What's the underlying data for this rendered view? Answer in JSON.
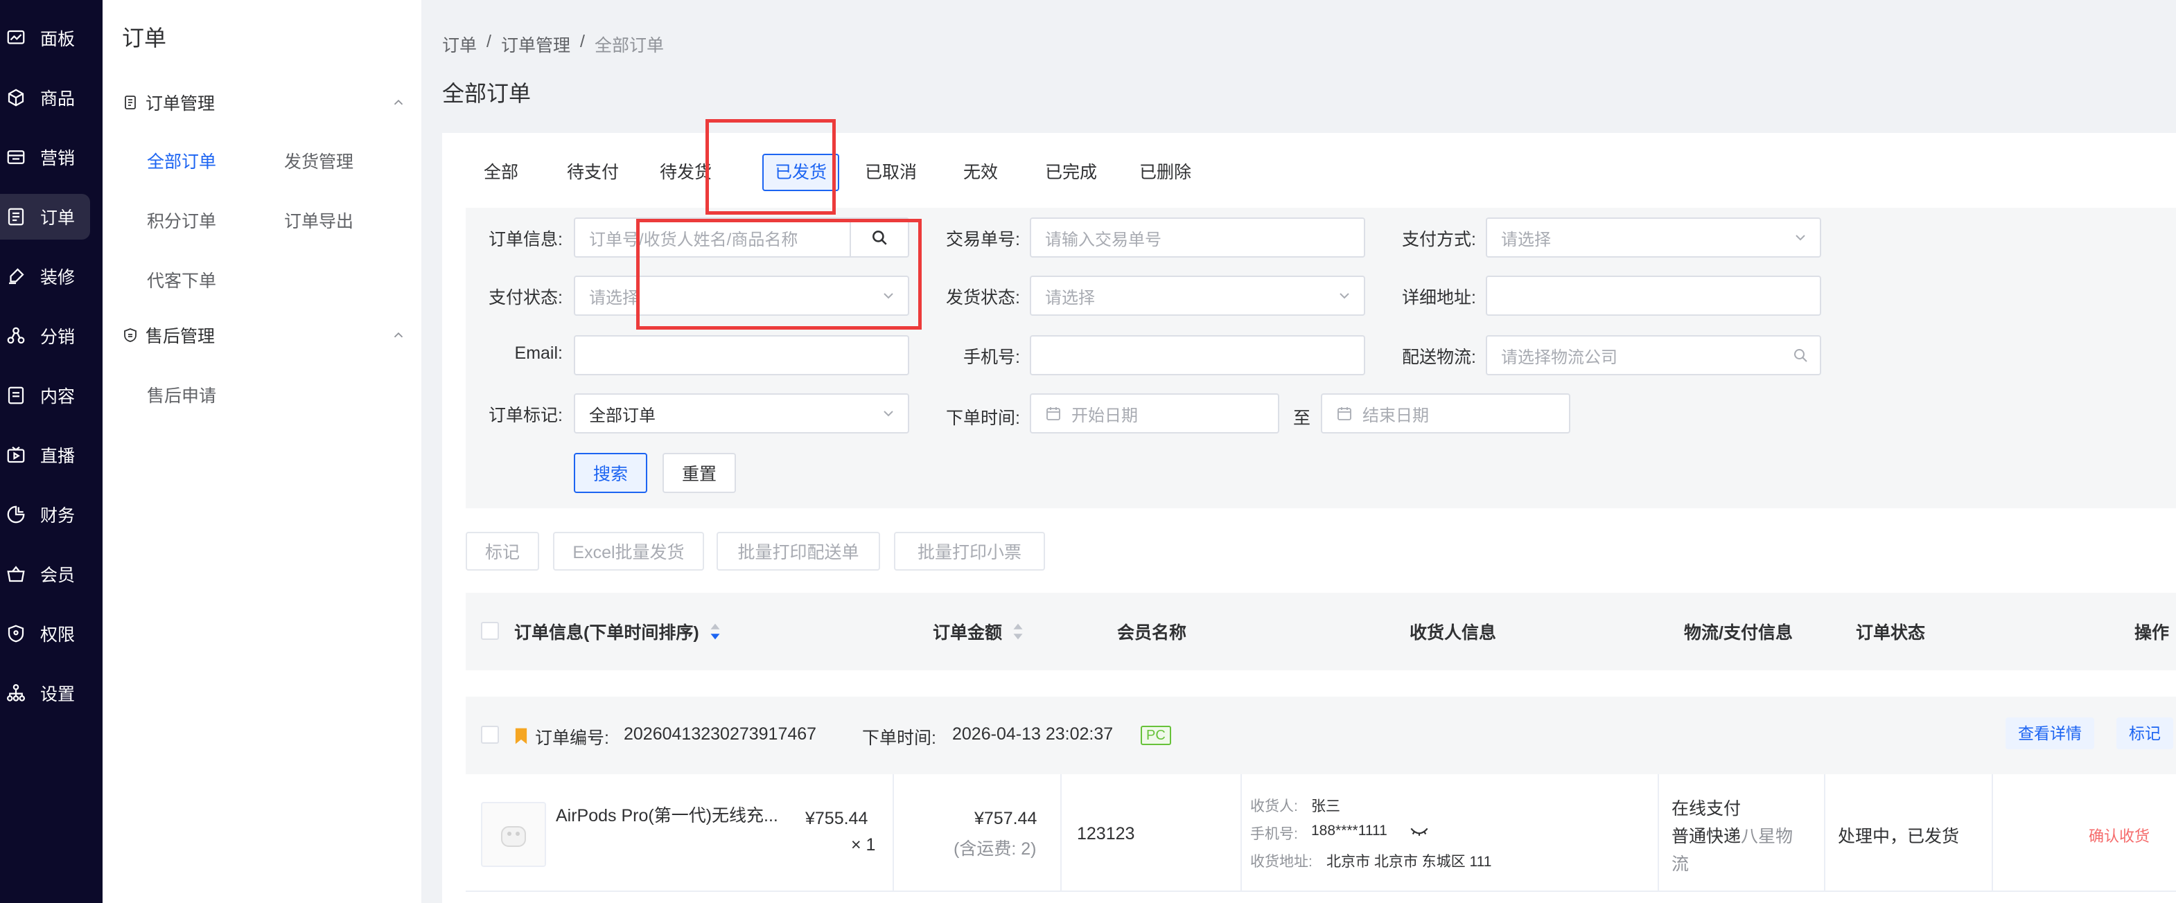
{
  "rail": {
    "items": [
      {
        "label": "面板",
        "icon": "dashboard-icon"
      },
      {
        "label": "商品",
        "icon": "cube-icon"
      },
      {
        "label": "营销",
        "icon": "ticket-icon"
      },
      {
        "label": "订单",
        "icon": "order-icon",
        "active": true
      },
      {
        "label": "装修",
        "icon": "brush-icon"
      },
      {
        "label": "分销",
        "icon": "share-icon"
      },
      {
        "label": "内容",
        "icon": "document-icon"
      },
      {
        "label": "直播",
        "icon": "live-icon"
      },
      {
        "label": "财务",
        "icon": "pie-icon"
      },
      {
        "label": "会员",
        "icon": "basket-icon"
      },
      {
        "label": "权限",
        "icon": "shield-icon"
      },
      {
        "label": "设置",
        "icon": "network-icon"
      }
    ]
  },
  "subnav": {
    "title": "订单",
    "groups": [
      {
        "label": "订单管理",
        "items": [
          "全部订单",
          "发货管理",
          "积分订单",
          "订单导出",
          "代客下单"
        ]
      },
      {
        "label": "售后管理",
        "items": [
          "售后申请"
        ]
      }
    ]
  },
  "breadcrumb": [
    "订单",
    "/",
    "订单管理",
    "/",
    "全部订单"
  ],
  "page_title": "全部订单",
  "tabs": [
    "全部",
    "待支付",
    "待发货",
    "已发货",
    "已取消",
    "无效",
    "已完成",
    "已删除"
  ],
  "filters": {
    "order_info": {
      "label": "订单信息:",
      "placeholder": "订单号/收货人姓名/商品名称"
    },
    "trade_no": {
      "label": "交易单号:",
      "placeholder": "请输入交易单号"
    },
    "pay_method": {
      "label": "支付方式:",
      "placeholder": "请选择"
    },
    "pay_status": {
      "label": "支付状态:",
      "placeholder": "请选择"
    },
    "ship_status": {
      "label": "发货状态:",
      "placeholder": "请选择"
    },
    "address": {
      "label": "详细地址:",
      "placeholder": ""
    },
    "email": {
      "label": "Email:",
      "placeholder": ""
    },
    "phone": {
      "label": "手机号:",
      "placeholder": ""
    },
    "logistics": {
      "label": "配送物流:",
      "placeholder": "请选择物流公司"
    },
    "order_mark": {
      "label": "订单标记:",
      "value": "全部订单"
    },
    "order_time": {
      "label": "下单时间:",
      "start": "开始日期",
      "to": "至",
      "end": "结束日期"
    },
    "search_label": "搜索",
    "reset_label": "重置"
  },
  "batch_actions": [
    "标记",
    "Excel批量发货",
    "批量打印配送单",
    "批量打印小票"
  ],
  "table_headers": {
    "info": "订单信息(下单时间排序)",
    "amount": "订单金额",
    "member": "会员名称",
    "receiver": "收货人信息",
    "logistics": "物流/支付信息",
    "status": "订单状态",
    "action": "操作"
  },
  "order": {
    "no_label": "订单编号:",
    "no": "20260413230273917467",
    "time_label": "下单时间:",
    "time": "2026-04-13 23:02:37",
    "badge": "PC",
    "detail_label": "查看详情",
    "mark_label": "标记",
    "product_name": "AirPods Pro(第一代)无线充...",
    "unit_price": "¥755.44",
    "qty": "× 1",
    "total": "¥757.44",
    "shipping_fee": "(含运费: 2)",
    "member": "123123",
    "receiver_label": "收货人:",
    "receiver": "张三",
    "phone_label": "手机号:",
    "phone": "188****1111",
    "addr_label": "收货地址:",
    "addr": "北京市 北京市 东城区 111",
    "pay_type": "在线支付",
    "ship_type": "普通快递",
    "carrier_part1": "八星物",
    "carrier_part2": "流",
    "status": "处理中，已发货",
    "confirm_label": "确认收货"
  },
  "colors": {
    "accent": "#1c64f2",
    "rail_bg": "#0c0a2a",
    "highlight": "#ec3b3b",
    "danger": "#f56c6c"
  }
}
